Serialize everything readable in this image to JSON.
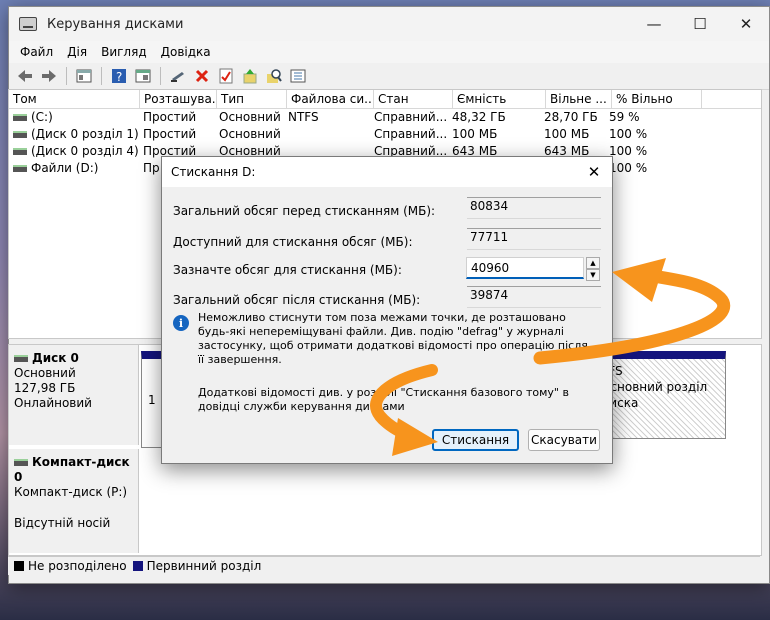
{
  "window": {
    "title": "Керування дисками",
    "controls": [
      "—",
      "☐",
      "✕"
    ]
  },
  "menu": [
    "Файл",
    "Дія",
    "Вигляд",
    "Довідка"
  ],
  "volumes": {
    "columns": [
      "Том",
      "Розташува...",
      "Тип",
      "Файлова си...",
      "Стан",
      "Ємність",
      "Вільне ...",
      "% Вільно"
    ],
    "rows": [
      [
        "(C:)",
        "Простий",
        "Основний",
        "NTFS",
        "Справний...",
        "48,32 ГБ",
        "28,70 ГБ",
        "59 %"
      ],
      [
        "(Диск 0 розділ 1)",
        "Простий",
        "Основний",
        "",
        "Справний...",
        "100 МБ",
        "100 МБ",
        "100 %"
      ],
      [
        "(Диск 0 розділ 4)",
        "Простий",
        "Основний",
        "",
        "Справний...",
        "643 МБ",
        "643 МБ",
        "100 %"
      ],
      [
        "Файли (D:)",
        "Пр",
        "",
        "",
        "",
        "",
        "",
        "100 %"
      ]
    ]
  },
  "disks": [
    {
      "name": "Диск 0",
      "type": "Основний",
      "size": "127,98 ГБ",
      "status": "Онлайновий"
    },
    {
      "name": "Компакт-диск 0",
      "type": "Компакт-диск (P:)",
      "size": "",
      "status": "Відсутній носій"
    }
  ],
  "partition_right": {
    "fs": "TFS",
    "desc": "Основний розділ диска"
  },
  "partition_left_glyph": "1",
  "legend": [
    {
      "label": "Не розподілено",
      "color": "#000000"
    },
    {
      "label": "Первинний розділ",
      "color": "#14147d"
    }
  ],
  "dialog": {
    "title": "Стискання D:",
    "total_before_label": "Загальний обсяг перед стисканням (МБ):",
    "total_before_value": "80834",
    "available_label": "Доступний для стискання обсяг (МБ):",
    "available_value": "77711",
    "shrink_label": "Зазначте обсяг для стискання (МБ):",
    "shrink_value": "40960",
    "total_after_label": "Загальний обсяг після стискання (МБ):",
    "total_after_value": "39874",
    "info_text": "Неможливо стиснути том поза межами точки, де розташовано будь-які непереміщувані файли. Див. подію \"defrag\" у журналі застосунку, щоб отримати додаткові відомості про операцію після її завершення.",
    "info2_text": "Додаткові відомості див. у розділі \"Стискання базового тому\" в довідці служби керування дисками",
    "shrink_button": "Стискання",
    "cancel_button": "Скасувати"
  },
  "colors": {
    "accent": "#0067c0",
    "arrow": "#f7941d",
    "partition": "#14147d"
  }
}
